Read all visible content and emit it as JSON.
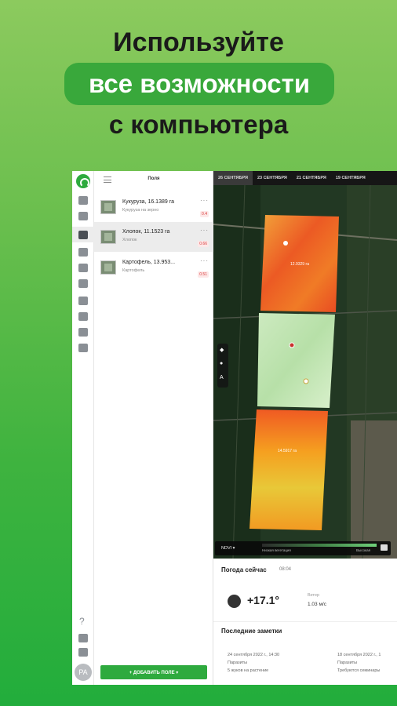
{
  "promo": {
    "line1": "Используйте",
    "highlight": "все возможности",
    "line3": "с компьютера"
  },
  "sidebar": {
    "help": "?",
    "avatar": "PA"
  },
  "panel": {
    "title": "Поля",
    "more": "···",
    "fields": [
      {
        "name": "Кукуруза, 16.1389 га",
        "crop": "Кукуруза на зерно",
        "ndvi": "0.4"
      },
      {
        "name": "Хлопок, 11.1523 га",
        "crop": "Хлопок",
        "ndvi": "0.66"
      },
      {
        "name": "Картофель, 13.953...",
        "crop": "Картофель",
        "ndvi": "0.51"
      }
    ],
    "add_button": "+ ДОБАВИТЬ ПОЛЕ ▾"
  },
  "map": {
    "dates": [
      "26 СЕНТЯБРЯ",
      "23 СЕНТЯБРЯ",
      "21 СЕНТЯБРЯ",
      "19 СЕНТЯБРЯ"
    ],
    "zone_labels": [
      "12.9329 га",
      "",
      "14.5917 га"
    ],
    "tool_text": "A",
    "index_select": "NDVI ▾",
    "legend_low": "Низкая вегетация",
    "legend_high": "Высокая"
  },
  "weather": {
    "title": "Погода сейчас",
    "time": "08:04",
    "temp": "+17.1°",
    "wind_label": "Ветер",
    "wind_value": "1.03 м/с"
  },
  "notes": {
    "title": "Последние заметки",
    "items": [
      {
        "date": "24 сентября 2022 г., 14:30",
        "type": "Паразиты",
        "text": "5 жуков на растение"
      },
      {
        "date": "18 сентября 2022 г., 1",
        "type": "Паразиты",
        "text": "Требуются семинары"
      }
    ]
  }
}
